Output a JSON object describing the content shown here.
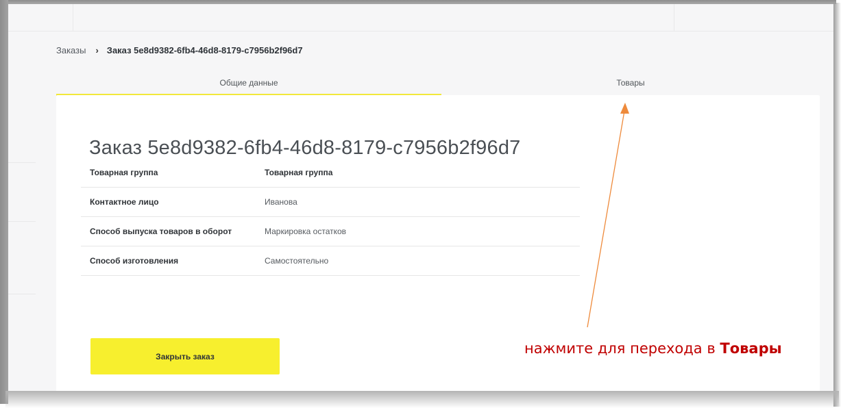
{
  "breadcrumb": {
    "parent": "Заказы",
    "separator": "›",
    "current": "Заказ 5e8d9382-6fb4-46d8-8179-c7956b2f96d7"
  },
  "tabs": [
    {
      "label": "Общие данные",
      "active": true
    },
    {
      "label": "Товары",
      "active": false
    }
  ],
  "order": {
    "title": "Заказ 5e8d9382-6fb4-46d8-8179-c7956b2f96d7",
    "rows": [
      {
        "label": "Товарная группа",
        "value": "Товарная группа"
      },
      {
        "label": "Контактное лицо",
        "value": "Иванова"
      },
      {
        "label": "Способ выпуска товаров в оборот",
        "value": "Маркировка остатков"
      },
      {
        "label": "Способ изготовления",
        "value": "Самостоятельно"
      }
    ],
    "close_button": "Закрыть заказ"
  },
  "annotation": {
    "text": "нажмите для перехода в ",
    "highlight": "Товары",
    "color": "#c00000",
    "arrow_color": "#ee8a3b"
  },
  "colors": {
    "accent_yellow": "#f7ef2e",
    "tab_underline": "#f1e83a"
  }
}
